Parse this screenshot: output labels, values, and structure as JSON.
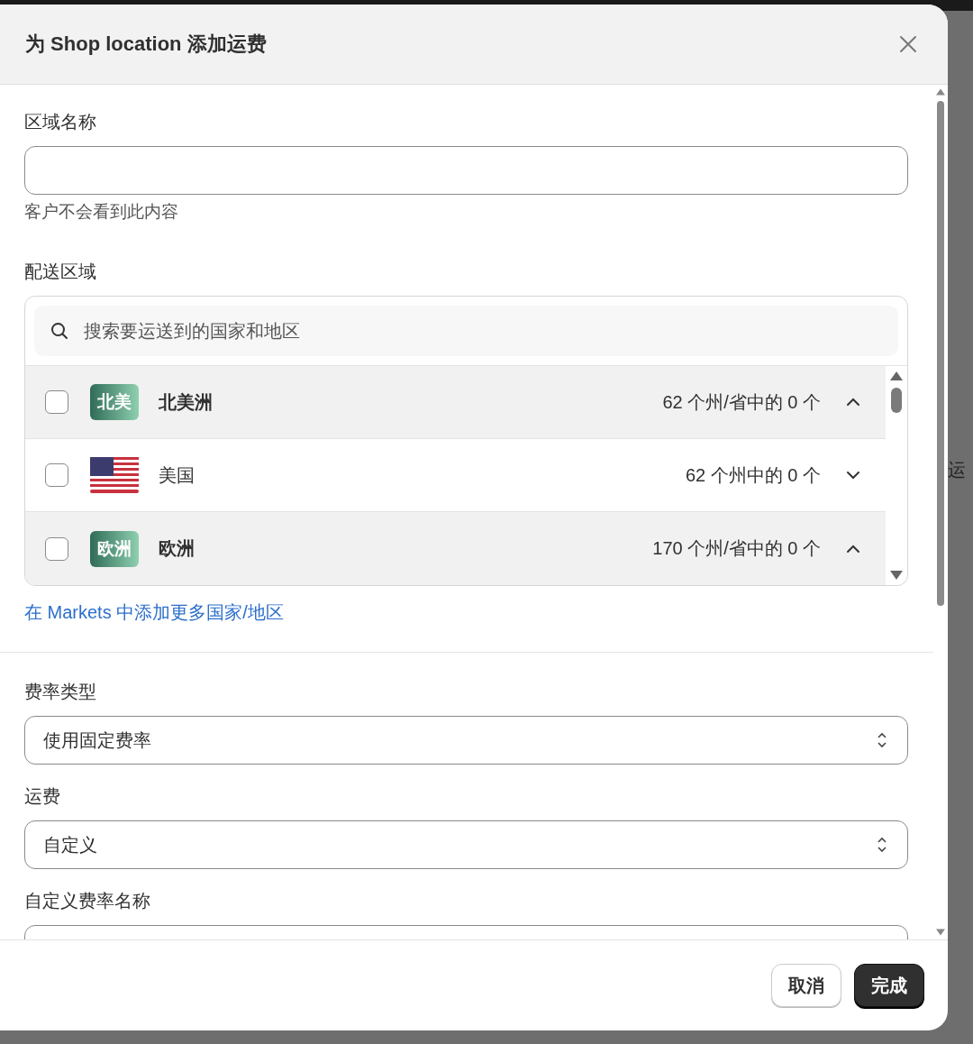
{
  "dialog": {
    "title": "为 Shop location 添加运费"
  },
  "zone_name": {
    "label": "区域名称",
    "help": "客户不会看到此内容"
  },
  "shipping_zones": {
    "label": "配送区域",
    "search": {
      "placeholder": "搜索要运送到的国家和地区"
    },
    "regions": [
      {
        "kind": "region",
        "badge": "北美",
        "name": "北美洲",
        "count": "62 个州/省中的 0 个",
        "checked": false,
        "expanded": true
      },
      {
        "kind": "country",
        "name": "美国",
        "count": "62 个州中的 0 个",
        "checked": false,
        "expanded": false
      },
      {
        "kind": "region",
        "badge": "欧洲",
        "name": "欧洲",
        "count": "170 个州/省中的 0 个",
        "checked": false,
        "expanded": true
      }
    ],
    "link": "在 Markets 中添加更多国家/地区"
  },
  "rate_type": {
    "label": "费率类型",
    "value": "使用固定费率"
  },
  "rate": {
    "label": "运费",
    "value": "自定义"
  },
  "custom_rate_name": {
    "label": "自定义费率名称"
  },
  "buttons": [
    {
      "label": "取消",
      "kind": "secondary"
    },
    {
      "label": "完成",
      "kind": "primary"
    }
  ],
  "background": {
    "text": "运"
  }
}
